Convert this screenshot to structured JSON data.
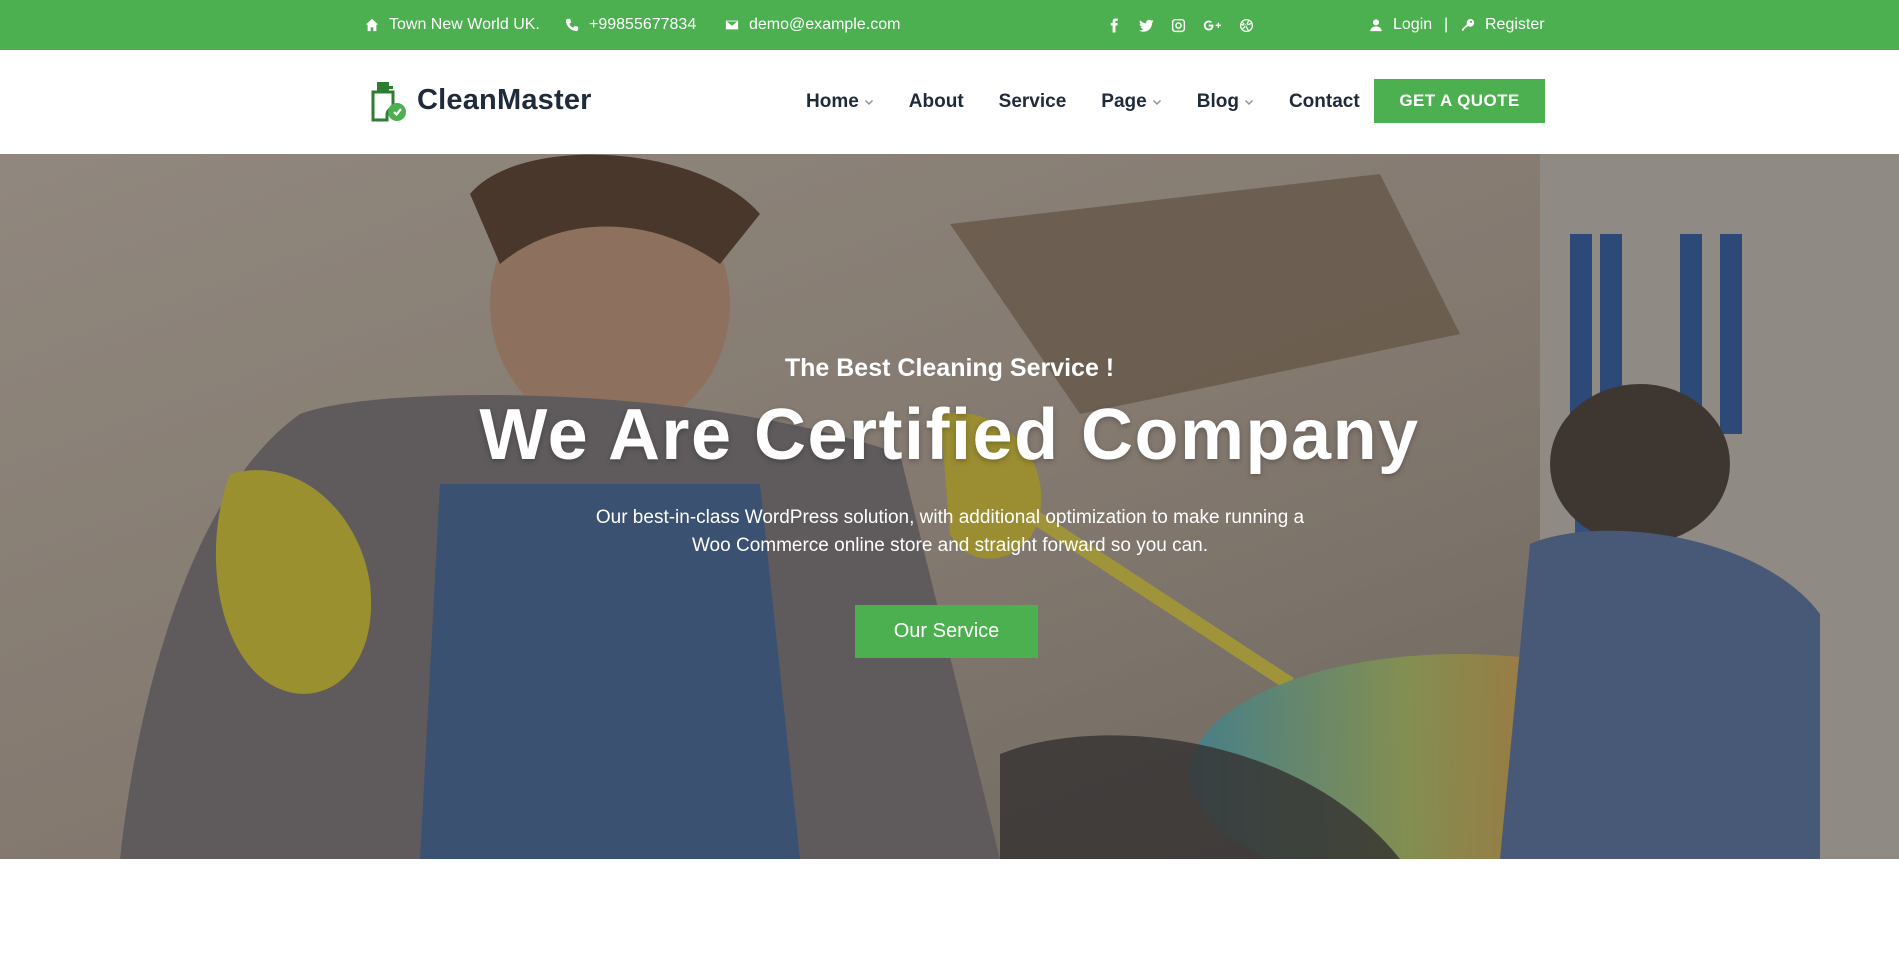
{
  "topbar": {
    "address": "Town New World UK.",
    "phone": "+99855677834",
    "email": "demo@example.com",
    "social": [
      "facebook-icon",
      "twitter-icon",
      "instagram-icon",
      "google-plus-icon",
      "dribbble-icon"
    ],
    "login": "Login",
    "separator": "|",
    "register": "Register"
  },
  "header": {
    "logo_text": "CleanMaster",
    "nav": [
      {
        "label": "Home",
        "dropdown": true
      },
      {
        "label": "About",
        "dropdown": false
      },
      {
        "label": "Service",
        "dropdown": false
      },
      {
        "label": "Page",
        "dropdown": true
      },
      {
        "label": "Blog",
        "dropdown": true
      },
      {
        "label": "Contact",
        "dropdown": false
      }
    ],
    "quote_button": "GET A QUOTE"
  },
  "hero": {
    "subtitle": "The Best Cleaning Service !",
    "title": "We Are Certified Company",
    "description": "Our best-in-class WordPress solution, with additional optimization to make running a Woo Commerce online store and straight forward so you can.",
    "button": "Our Service"
  },
  "colors": {
    "accent": "#4caf50",
    "dark_text": "#1f2a3a"
  }
}
